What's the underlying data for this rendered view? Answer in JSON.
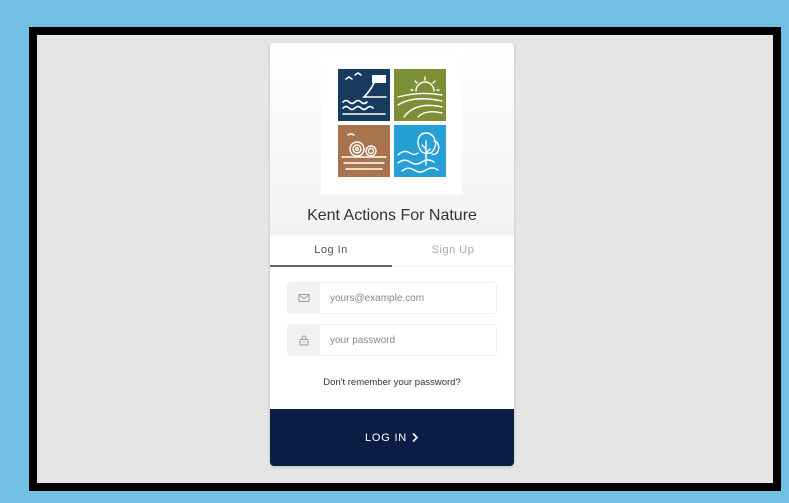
{
  "app": {
    "title": "Kent Actions For Nature"
  },
  "logo": {
    "tiles": [
      "coast-tile-icon",
      "farmland-sun-tile-icon",
      "hay-bales-tile-icon",
      "trees-water-tile-icon"
    ],
    "colors": [
      "#173a5e",
      "#7d8f36",
      "#a9744d",
      "#259fd6"
    ]
  },
  "tabs": {
    "login": "Log In",
    "signup": "Sign Up",
    "active": "login"
  },
  "form": {
    "email_placeholder": "yours@example.com",
    "email_icon": "envelope-icon",
    "password_placeholder": "your password",
    "password_icon": "lock-icon",
    "forgot_link": "Don't remember your password?",
    "submit_label": "LOG IN",
    "submit_icon": "chevron-right-icon"
  },
  "colors": {
    "page_border": "#6fc0e3",
    "frame": "#000000",
    "backdrop": "#e5e5e5",
    "submit_bg": "#0a1e45"
  }
}
